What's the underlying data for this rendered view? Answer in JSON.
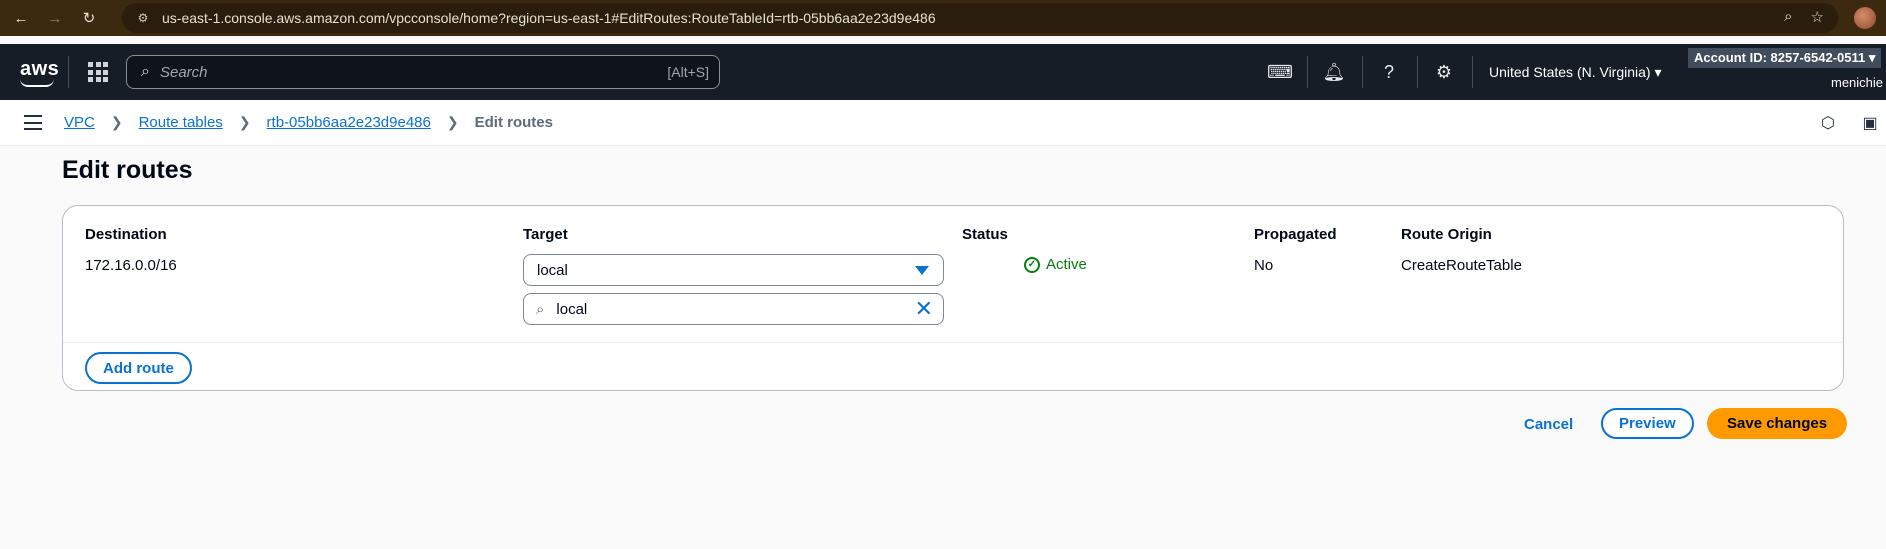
{
  "browser": {
    "url": "us-east-1.console.aws.amazon.com/vpcconsole/home?region=us-east-1#EditRoutes:RouteTableId=rtb-05bb6aa2e23d9e486"
  },
  "topnav": {
    "logo": "aws",
    "search_placeholder": "Search",
    "search_shortcut": "[Alt+S]",
    "region": "United States (N. Virginia) ▾",
    "account": "Account ID: 8257-6542-0511 ▾",
    "username": "menichie"
  },
  "breadcrumb": {
    "items": [
      "VPC",
      "Route tables",
      "rtb-05bb6aa2e23d9e486"
    ],
    "current": "Edit routes"
  },
  "page": {
    "title": "Edit routes"
  },
  "routes": {
    "headers": {
      "destination": "Destination",
      "target": "Target",
      "status": "Status",
      "propagated": "Propagated",
      "route_origin": "Route Origin"
    },
    "rows": [
      {
        "destination": "172.16.0.0/16",
        "target": "local",
        "target_filter": "local",
        "status": "Active",
        "propagated": "No",
        "route_origin": "CreateRouteTable"
      }
    ],
    "add_route_label": "Add route"
  },
  "footer": {
    "cancel_label": "Cancel",
    "preview_label": "Preview",
    "save_label": "Save changes"
  },
  "colors": {
    "link": "#0972d3",
    "primary": "#ff9900",
    "success": "#037f0c",
    "nav_bg": "#161d26"
  }
}
